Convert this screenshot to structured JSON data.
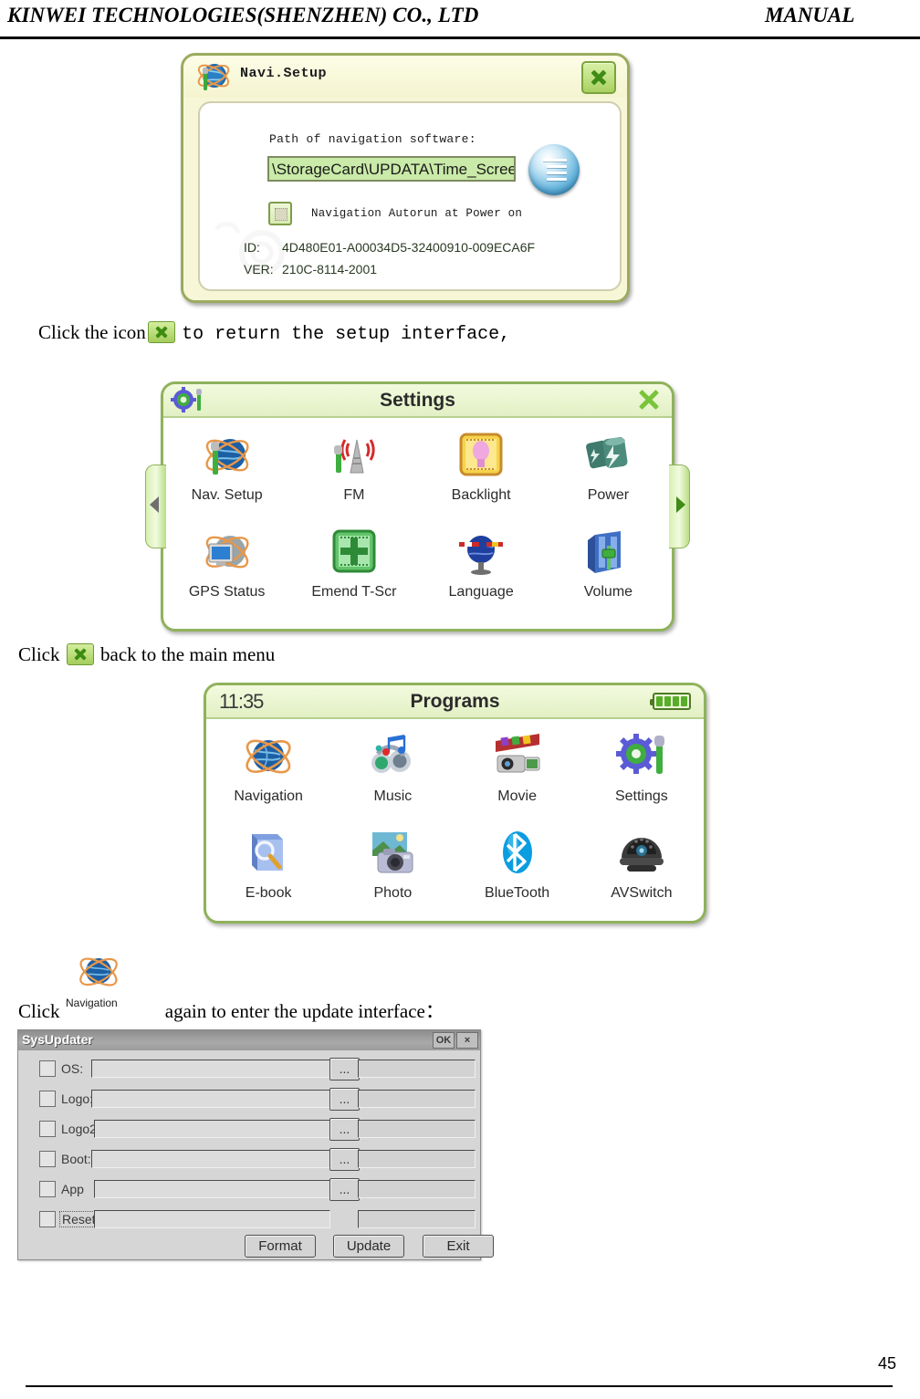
{
  "header": {
    "left": "KINWEI TECHNOLOGIES(SHENZHEN) CO., LTD",
    "right": "MANUAL"
  },
  "footer": {
    "page_number": "45"
  },
  "navi_setup_window": {
    "title": "Navi.Setup",
    "title_icon": "globe-wrench-icon",
    "close_icon": "close-x-icon",
    "path_label": "Path of navigation software:",
    "path_value": "\\StorageCard\\UPDATA\\Time_ScreenCa",
    "browse_icon": "list-lines-icon",
    "autorun_label": "Navigation Autorun at Power on",
    "autorun_checked": false,
    "id_key": "ID:",
    "id_value": "4D480E01-A00034D5-32400910-009ECA6F",
    "ver_key": "VER:",
    "ver_value": "210C-8114-2001"
  },
  "instruction_1": {
    "before": "Click the icon",
    "icon": "close-x-icon",
    "after": "to return the setup interface,"
  },
  "settings_window": {
    "title": "Settings",
    "title_icon": "gear-wrench-icon",
    "close_icon": "close-x-icon",
    "prev_arrow": "chevron-left-icon",
    "next_arrow": "chevron-right-icon",
    "items": [
      {
        "label": "Nav. Setup",
        "icon": "globe-wrench-icon"
      },
      {
        "label": "FM",
        "icon": "radio-tower-icon"
      },
      {
        "label": "Backlight",
        "icon": "lightbulb-icon"
      },
      {
        "label": "Power",
        "icon": "battery-bolt-icon"
      },
      {
        "label": "GPS Status",
        "icon": "monitor-globe-icon"
      },
      {
        "label": "Emend T-Scr",
        "icon": "crosshair-icon"
      },
      {
        "label": "Language",
        "icon": "globe-flags-icon"
      },
      {
        "label": "Volume",
        "icon": "volume-slider-icon"
      }
    ]
  },
  "instruction_2": {
    "before": "Click",
    "icon": "close-x-icon",
    "after": "back to the main menu"
  },
  "programs_window": {
    "clock": "11:35",
    "title": "Programs",
    "battery_icon": "battery-full-icon",
    "battery_bars": 4,
    "items": [
      {
        "label": "Navigation",
        "icon": "globe-orbit-icon"
      },
      {
        "label": "Music",
        "icon": "headphones-notes-icon"
      },
      {
        "label": "Movie",
        "icon": "camcorder-film-icon"
      },
      {
        "label": "Settings",
        "icon": "gear-wrench-icon"
      },
      {
        "label": "E-book",
        "icon": "book-magnifier-icon"
      },
      {
        "label": "Photo",
        "icon": "camera-photo-icon"
      },
      {
        "label": "BlueTooth",
        "icon": "bluetooth-icon"
      },
      {
        "label": "AVSwitch",
        "icon": "dome-camera-icon"
      }
    ]
  },
  "instruction_3": {
    "before": "Click",
    "icon": "globe-orbit-icon",
    "icon_caption": "Navigation",
    "after": "again to enter the update interface："
  },
  "sysupdater": {
    "title": "SysUpdater",
    "ok_label": "OK",
    "close_label": "×",
    "rows": [
      {
        "label": "OS:",
        "value": "",
        "checked": false,
        "browse": "...",
        "has_browse": true
      },
      {
        "label": "Logo:",
        "value": "",
        "checked": false,
        "browse": "...",
        "has_browse": true
      },
      {
        "label": "Logo2:",
        "value": "",
        "checked": false,
        "browse": "...",
        "has_browse": true
      },
      {
        "label": "Boot:",
        "value": "",
        "checked": false,
        "browse": "...",
        "has_browse": true
      },
      {
        "label": "App",
        "value": "",
        "checked": false,
        "browse": "...",
        "has_browse": true
      },
      {
        "label": "Reset",
        "value": "",
        "checked": false,
        "browse": "",
        "has_browse": false
      }
    ],
    "buttons": [
      {
        "label": "Format"
      },
      {
        "label": "Update"
      },
      {
        "label": "Exit"
      }
    ]
  },
  "colors": {
    "device_border": "#8fb25c",
    "device_title_bg": "#e2f0c4",
    "navi_window_bg": "#f7f7d8",
    "path_field_bg": "#c9eaa8",
    "close_green": "#79c43a",
    "sysupdater_bg": "#d6d6d6"
  }
}
